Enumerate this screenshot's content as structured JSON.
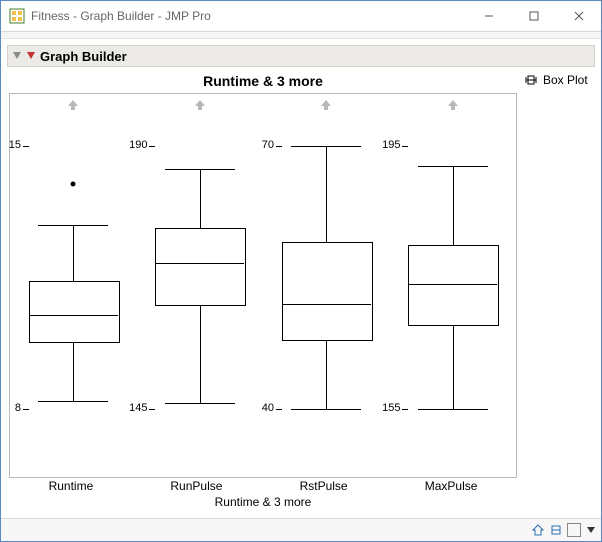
{
  "window": {
    "title": "Fitness - Graph Builder - JMP Pro"
  },
  "section": {
    "label": "Graph Builder"
  },
  "plot": {
    "title": "Runtime & 3 more",
    "axis_title": "Runtime & 3 more",
    "categories": [
      "Runtime",
      "RunPulse",
      "RstPulse",
      "MaxPulse"
    ]
  },
  "legend": {
    "label": "Box Plot"
  },
  "chart_data": {
    "type": "boxplot",
    "note": "Values estimated from plotted positions; each variable is scaled independently to a common vertical extent (parallel-axis box plot).",
    "series": [
      {
        "name": "Runtime",
        "axis_min": 8,
        "axis_max": 15,
        "min": 8.2,
        "q1": 9.8,
        "median": 10.5,
        "q3": 11.4,
        "max": 12.9,
        "outliers": [
          14.0
        ],
        "labels": {
          "top": "15",
          "bottom": "8"
        }
      },
      {
        "name": "RunPulse",
        "axis_min": 145,
        "axis_max": 190,
        "min": 146,
        "q1": 163,
        "median": 170,
        "q3": 176,
        "max": 186,
        "outliers": [],
        "labels": {
          "top": "190",
          "bottom": "145"
        }
      },
      {
        "name": "RstPulse",
        "axis_min": 40,
        "axis_max": 70,
        "min": 40,
        "q1": 48,
        "median": 52,
        "q3": 59,
        "max": 70,
        "outliers": [],
        "labels": {
          "top": "70",
          "bottom": "40"
        }
      },
      {
        "name": "MaxPulse",
        "axis_min": 155,
        "axis_max": 195,
        "min": 155,
        "q1": 168,
        "median": 174,
        "q3": 180,
        "max": 192,
        "outliers": [],
        "labels": {
          "top": "195",
          "bottom": "155"
        }
      }
    ]
  }
}
